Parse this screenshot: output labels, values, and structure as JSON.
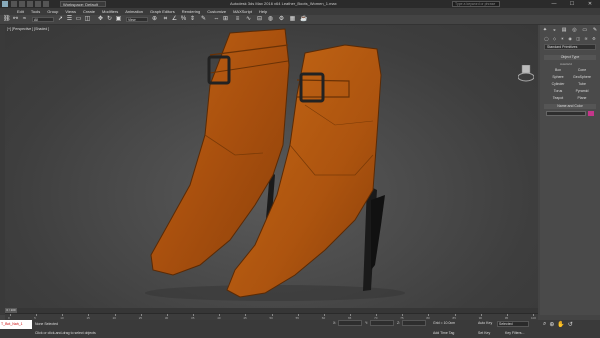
{
  "titlebar": {
    "workspace": "Workspace: Default",
    "title": "Autodesk 3ds Max 2016 x64     Leather_Boots_Women_1.max",
    "search_placeholder": "Type a keyword or phrase",
    "min": "—",
    "max": "☐",
    "close": "✕"
  },
  "menu": [
    "Edit",
    "Tools",
    "Group",
    "Views",
    "Create",
    "Modifiers",
    "Animation",
    "Graph Editors",
    "Rendering",
    "Customize",
    "MAXScript",
    "Help"
  ],
  "toolbar": {
    "filter": "All",
    "refcoord": "View"
  },
  "viewport": {
    "label": "[+] [Perspective ] [Shaded ]"
  },
  "command_panel": {
    "tabs": [
      "✦",
      "◒",
      "▤",
      "◎",
      "▭",
      "✎"
    ],
    "subtabs": [
      "◯",
      "◇",
      "☀",
      "◉",
      "◫",
      "≋",
      "⚙"
    ],
    "category": "Standard Primitives",
    "object_type": "Object Type",
    "autogrid": "AutoGrid",
    "buttons": [
      "Box",
      "Cone",
      "Sphere",
      "GeoSphere",
      "Cylinder",
      "Tube",
      "Torus",
      "Pyramid",
      "Teapot",
      "Plane"
    ],
    "name_and_color": "Name and Color",
    "swatch_color": "#c4368a"
  },
  "timeline": {
    "slider": "0 / 100",
    "ticks": [
      "0",
      "5",
      "10",
      "15",
      "20",
      "25",
      "30",
      "35",
      "40",
      "45",
      "50",
      "55",
      "60",
      "65",
      "70",
      "75",
      "80",
      "85",
      "90",
      "95",
      "100"
    ]
  },
  "status": {
    "maxscript": "T_Bot_Nah_1",
    "line1": "None Selected",
    "line2": "Click or click-and-drag to select objects",
    "x": "X:",
    "y": "Y:",
    "z": "Z:",
    "grid": "Grid = 10.0cm",
    "add_time_tag": "Add Time Tag",
    "auto_key": "Auto Key",
    "selected": "Selected",
    "set_key": "Set Key",
    "key_filters": "Key Filters..."
  },
  "colors": {
    "boot": "#b0540f",
    "heel": "#1a1a1a",
    "buckle": "#222222"
  }
}
